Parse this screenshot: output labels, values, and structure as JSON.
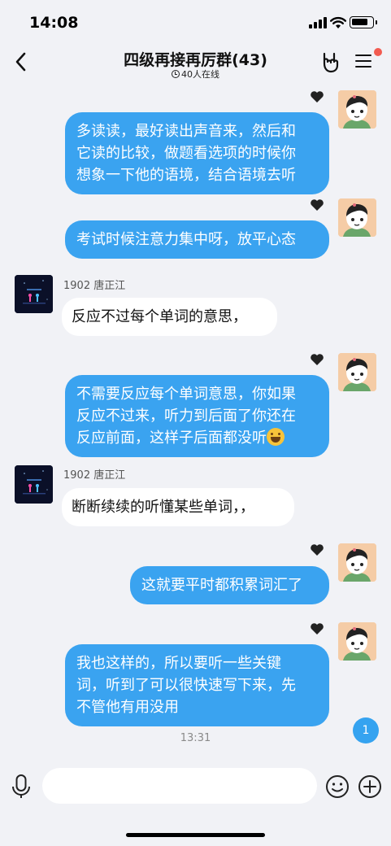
{
  "status_bar": {
    "time": "14:08"
  },
  "header": {
    "title": "四级再接再厉群(43)",
    "online": "40人在线",
    "menu_badge_color": "#f25b50"
  },
  "messages": [
    {
      "id": 1,
      "from": "me",
      "text": "多读读，最好读出声音来，然后和它读的比较，做题看选项的时候你想象一下他的语境，结合语境去听",
      "lines": [
        "多读读，最好读出声音来，然后和",
        "它读的比较，做题看选项的时候你",
        "想象一下他的语境，结合语境去听"
      ]
    },
    {
      "id": 2,
      "from": "me",
      "text": "考试时候注意力集中呀，放平心态"
    },
    {
      "id": 3,
      "from": "other",
      "sender": "1902  唐正江",
      "text": "反应不过每个单词的意思，"
    },
    {
      "id": 4,
      "from": "me",
      "lines": [
        "不需要反应每个单词意思，你如果",
        "反应不过来，听力到后面了你还在",
        "反应前面，这样子后面都没听"
      ],
      "emoji": "grinning-sweat-emoji"
    },
    {
      "id": 5,
      "from": "other",
      "sender": "1902  唐正江",
      "text": "断断续续的听懂某些单词，，"
    },
    {
      "id": 6,
      "from": "me",
      "text": "这就要平时都积累词汇了"
    },
    {
      "id": 7,
      "from": "me",
      "lines": [
        "我也这样的，所以要听一些关键",
        "词，听到了可以很快速写下来，先",
        "不管他有用没用"
      ]
    }
  ],
  "timestamp": "13:31",
  "unread_count": "1",
  "input": {
    "placeholder": "",
    "value": ""
  },
  "colors": {
    "bubble_me": "#3aa3f0",
    "bubble_other": "#ffffff",
    "background": "#f1f2f6"
  }
}
